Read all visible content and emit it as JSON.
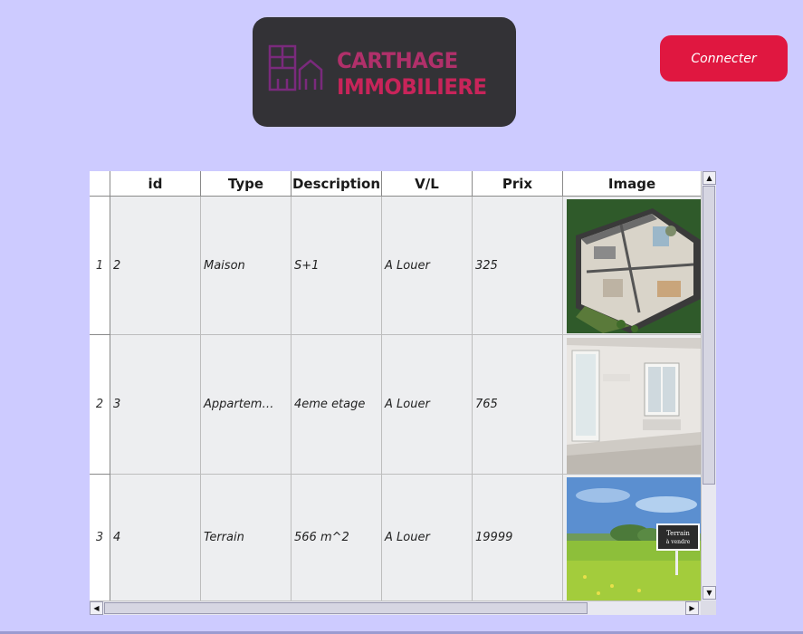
{
  "logo": {
    "line1": "CARTHAGE",
    "line2": "IMMOBILIERE",
    "icon": "building-icon",
    "colors": {
      "bg": "#333236",
      "text1": "#b1306a",
      "text2": "#c8245a"
    }
  },
  "header": {
    "connect_label": "Connecter",
    "connect_color": "#e01740"
  },
  "table": {
    "columns": [
      "id",
      "Type",
      "Description",
      "V/L",
      "Prix",
      "Image"
    ],
    "rows": [
      {
        "num": "1",
        "id": "2",
        "type": "Maison",
        "description": "S+1",
        "vl": "A Louer",
        "prix": "325",
        "image": "house-3d-plan-image"
      },
      {
        "num": "2",
        "id": "3",
        "type": "Appartem…",
        "description": "4eme etage",
        "vl": "A Louer",
        "prix": "765",
        "image": "apartment-interior-image"
      },
      {
        "num": "3",
        "id": "4",
        "type": "Terrain",
        "description": "566 m^2",
        "vl": "A Louer",
        "prix": "19999",
        "image": "land-field-image"
      }
    ],
    "sign_text": [
      "Terrain",
      "à vendre"
    ]
  },
  "colors": {
    "background": "#cdcbff",
    "cell_bg": "#edeef0"
  }
}
